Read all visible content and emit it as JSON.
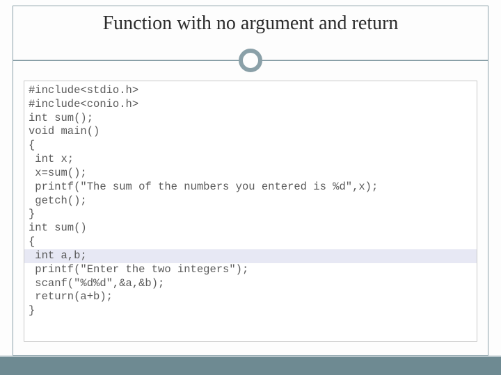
{
  "title": "Function with no argument and return",
  "code": {
    "lines": [
      "#include<stdio.h>",
      "#include<conio.h>",
      "int sum();",
      "void main()",
      "{",
      " int x;",
      " x=sum();",
      " printf(\"The sum of the numbers you entered is %d\",x);",
      " getch();",
      "}",
      "int sum()",
      "{",
      " int a,b;",
      " printf(\"Enter the two integers\");",
      " scanf(\"%d%d\",&a,&b);",
      " return(a+b);",
      "}"
    ],
    "highlight_index": 12
  }
}
